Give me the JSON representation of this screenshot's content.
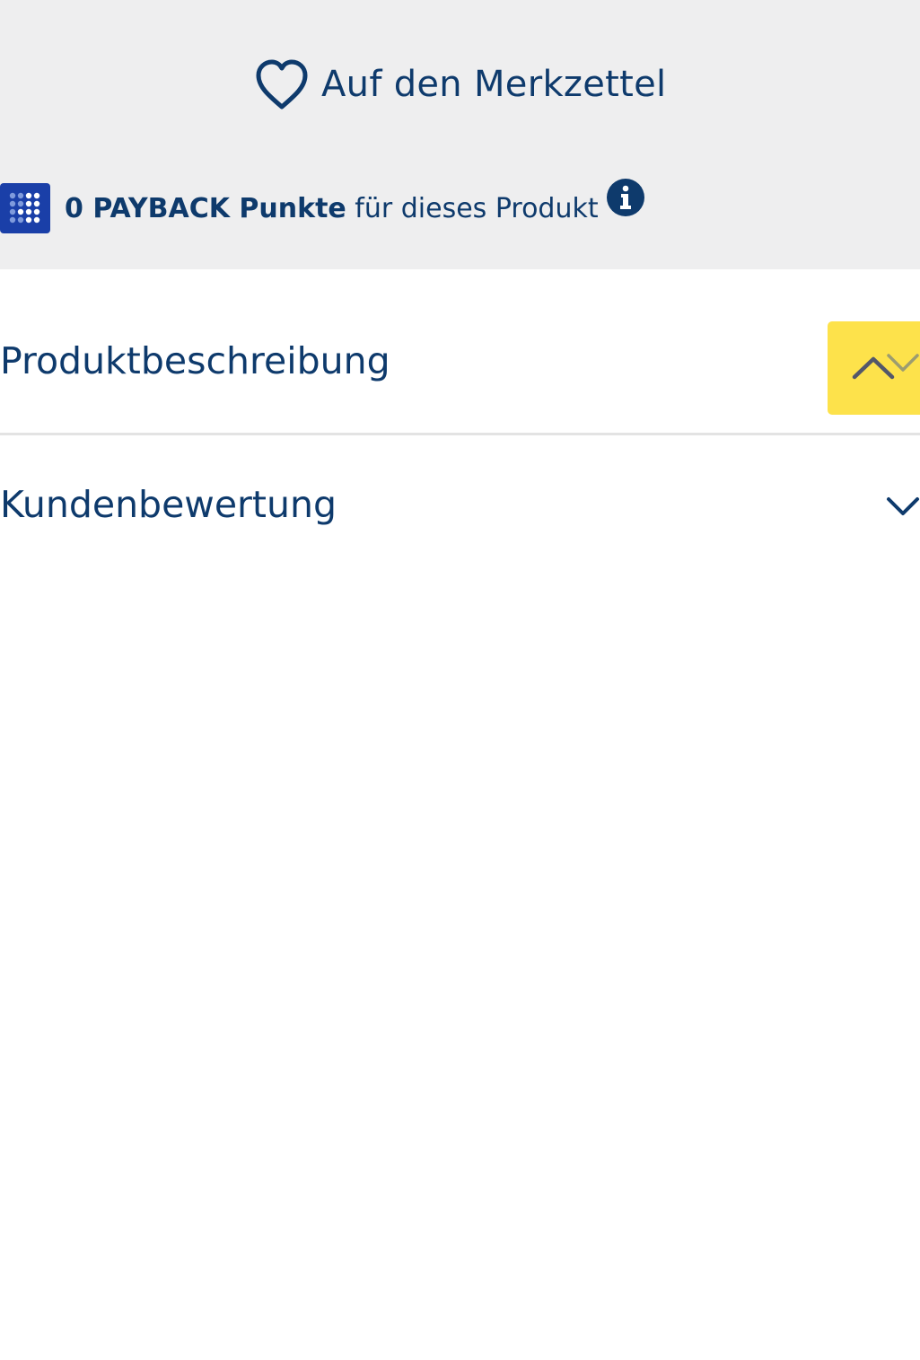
{
  "wishlist": {
    "label": "Auf den Merkzettel",
    "icon": "heart-icon"
  },
  "payback": {
    "logo": "payback-logo-icon",
    "points_bold": "0 PAYBACK Punkte",
    "points_suffix": " für dieses Produkt",
    "info_icon": "info-icon",
    "brand_color": "#1a3fa8"
  },
  "accordion": {
    "items": [
      {
        "title": "Produktbeschreibung",
        "state": "expanded",
        "icon": "chevron-up-icon"
      },
      {
        "title": "Kundenbewertung",
        "state": "collapsed",
        "icon": "chevron-down-icon"
      }
    ]
  },
  "colors": {
    "text": "#0e3a6c",
    "panel_bg": "#eeeeef",
    "accent_yellow": "#fde24b",
    "divider": "#e3e3e3"
  }
}
